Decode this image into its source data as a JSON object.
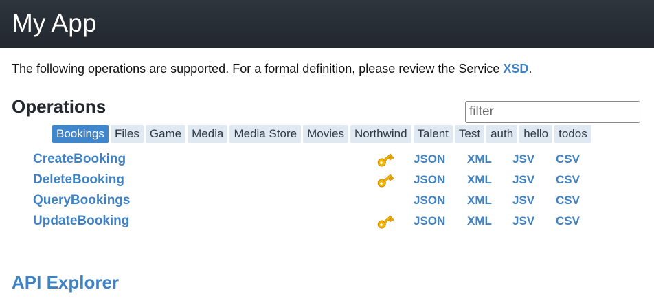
{
  "app": {
    "title": "My App"
  },
  "intro": {
    "text": "The following operations are supported. For a formal definition, please review the Service ",
    "link": "XSD",
    "suffix": "."
  },
  "operations": {
    "heading": "Operations",
    "filter_placeholder": "filter",
    "tabs": [
      "Bookings",
      "Files",
      "Game",
      "Media",
      "Media Store",
      "Movies",
      "Northwind",
      "Talent",
      "Test",
      "auth",
      "hello",
      "todos"
    ],
    "active_tab": "Bookings",
    "formats": [
      "JSON",
      "XML",
      "JSV",
      "CSV"
    ],
    "rows": [
      {
        "name": "CreateBooking",
        "requires_auth": true
      },
      {
        "name": "DeleteBooking",
        "requires_auth": true
      },
      {
        "name": "QueryBookings",
        "requires_auth": false
      },
      {
        "name": "UpdateBooking",
        "requires_auth": true
      }
    ]
  },
  "explorer": {
    "label": "API Explorer"
  },
  "colors": {
    "header_bg": "#2a3038",
    "link": "#3f82c4",
    "tab_bg": "#e0e9f2",
    "tab_active_bg": "#3f86cd",
    "key_icon": "#f2b705"
  },
  "icons": {
    "auth": "key-icon"
  }
}
